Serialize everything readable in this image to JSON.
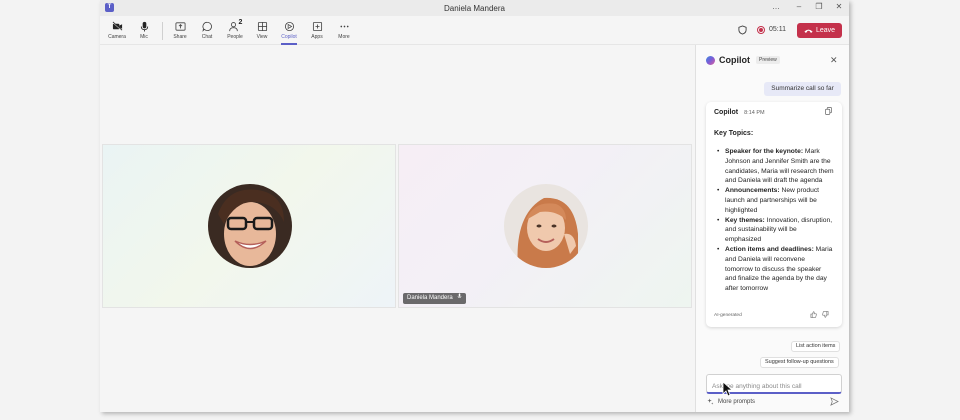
{
  "window": {
    "title": "Daniela Mandera",
    "app_icon": "teams-icon"
  },
  "window_controls": [
    "…",
    "–",
    "❐",
    "✕"
  ],
  "toolbar": {
    "items": [
      {
        "label": "Camera",
        "icon": "camera-icon"
      },
      {
        "label": "Mic",
        "icon": "mic-icon"
      },
      {
        "label": "Share",
        "icon": "share-icon"
      },
      {
        "label": "Chat",
        "icon": "chat-icon"
      },
      {
        "label": "People",
        "icon": "people-icon",
        "count": "2"
      },
      {
        "label": "View",
        "icon": "view-icon"
      },
      {
        "label": "Copilot",
        "icon": "copilot-icon",
        "active": true
      },
      {
        "label": "Apps",
        "icon": "apps-icon"
      },
      {
        "label": "More",
        "icon": "more-icon"
      }
    ],
    "timer": "05:11",
    "leave_label": "Leave"
  },
  "participants": [
    {
      "name": "",
      "avatar": "woman-glasses-avatar"
    },
    {
      "name": "Daniela Mandera",
      "avatar": "woman-red-hair-avatar",
      "muted": true
    }
  ],
  "copilot": {
    "title": "Copilot",
    "badge": "Preview",
    "user_prompt": "Summarize call so far",
    "response": {
      "author": "Copilot",
      "time": "8:14 PM",
      "heading": "Key Topics:",
      "items": [
        {
          "bold": "Speaker for the keynote:",
          "text": " Mark Johnson and Jennifer Smith are the candidates, Maria will research them and Daniela will draft the agenda"
        },
        {
          "bold": "Announcements:",
          "text": " New product launch and partnerships will be highlighted"
        },
        {
          "bold": "Key themes:",
          "text": " Innovation, disruption, and sustainability will be emphasized"
        },
        {
          "bold": "Action items and deadlines:",
          "text": " Maria and Daniela will reconvene tomorrow to discuss the speaker and finalize the agenda by the day after tomorrow"
        }
      ],
      "footer": "AI-generated"
    },
    "suggestions": [
      "List action items",
      "Suggest follow-up questions"
    ],
    "input_placeholder": "Ask me anything about this call",
    "more_prompts": "More prompts"
  },
  "colors": {
    "accent": "#5b5fc7",
    "leave": "#c4314b"
  }
}
